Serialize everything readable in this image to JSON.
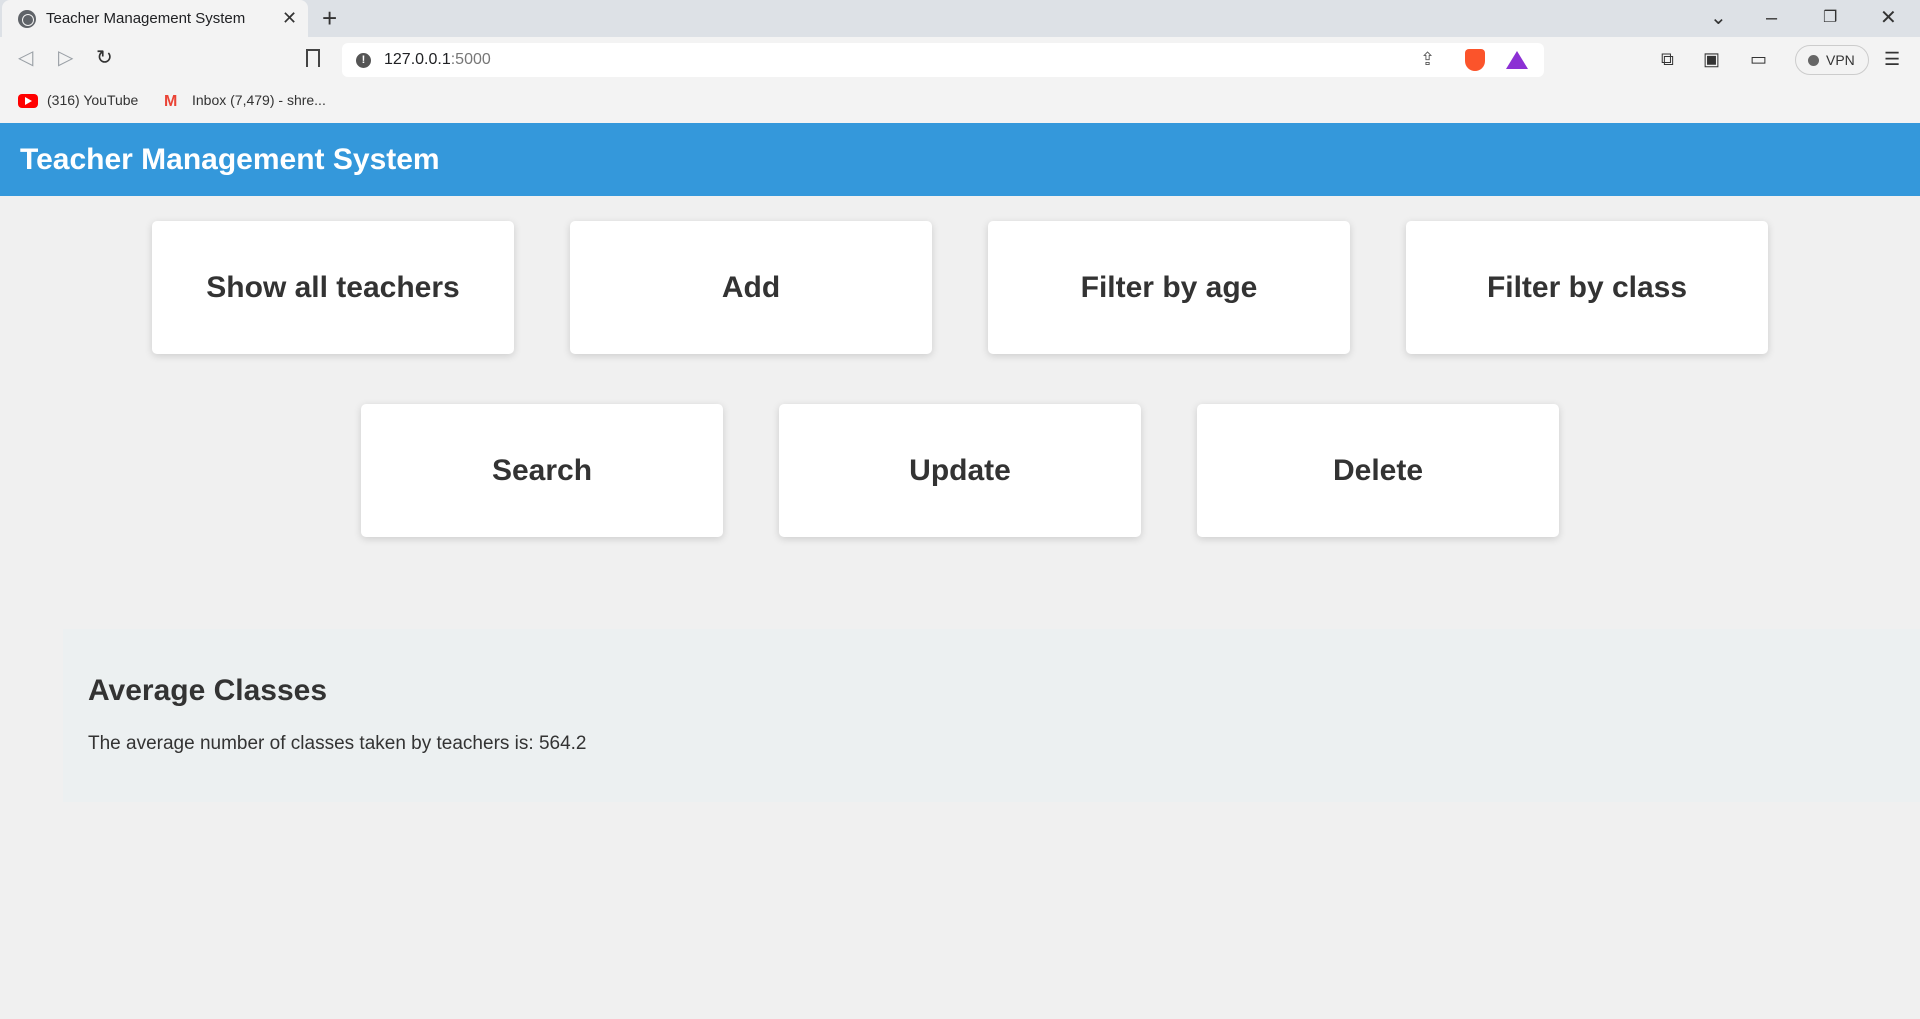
{
  "browser": {
    "tab_title": "Teacher Management System",
    "tab_close": "✕",
    "new_tab": "+",
    "url_host": "127.0.0.1",
    "url_port": ":5000",
    "vpn_label": "VPN",
    "bookmarks": [
      {
        "label": "(316) YouTube"
      },
      {
        "label": "Inbox (7,479) - shre..."
      }
    ]
  },
  "header": {
    "title": "Teacher Management System",
    "color": "#3498db"
  },
  "actions": {
    "row1": [
      "Show all teachers",
      "Add",
      "Filter by age",
      "Filter by class"
    ],
    "row2": [
      "Search",
      "Update",
      "Delete"
    ]
  },
  "average": {
    "title": "Average Classes",
    "text": "The average number of classes taken by teachers is: 564.2"
  }
}
